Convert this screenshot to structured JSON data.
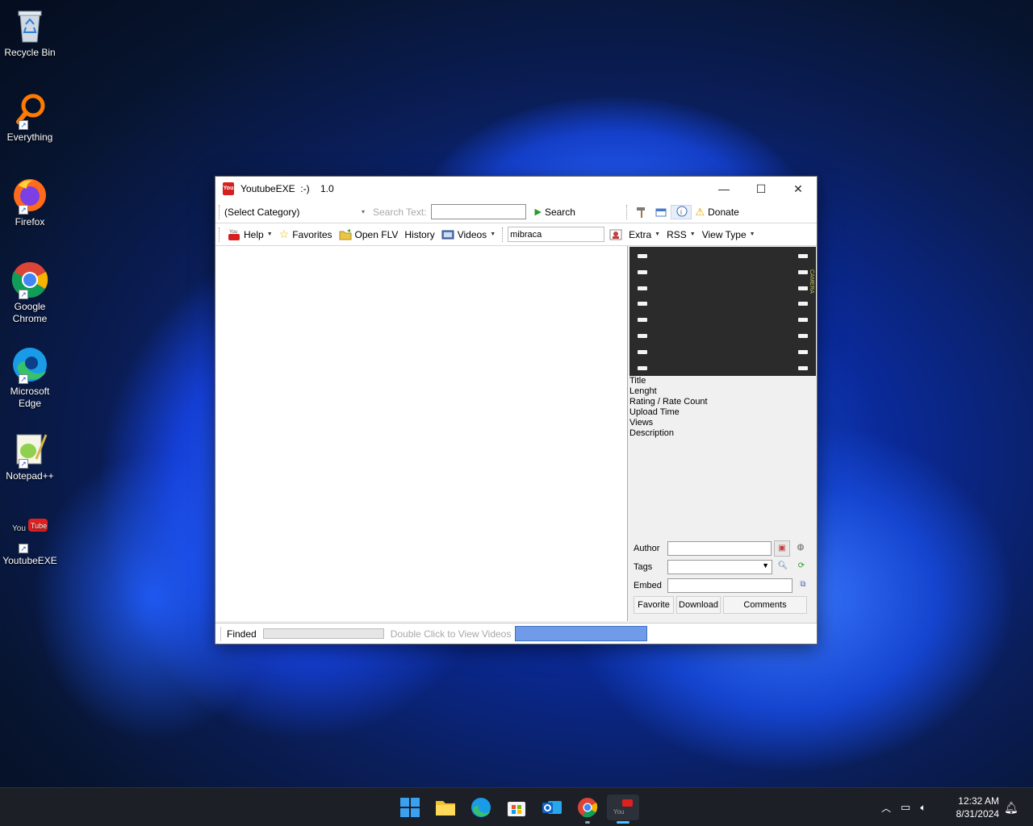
{
  "desktop": {
    "icons": [
      {
        "label": "Recycle Bin"
      },
      {
        "label": "Everything"
      },
      {
        "label": "Firefox"
      },
      {
        "label": "Google Chrome"
      },
      {
        "label": "Microsoft Edge"
      },
      {
        "label": "Notepad++"
      },
      {
        "label": "YoutubeEXE"
      }
    ]
  },
  "window": {
    "title": "YoutubeEXE  :-)    1.0",
    "app_icon_text": "You",
    "controls": {
      "minimize": "—",
      "maximize": "☐",
      "close": "✕"
    },
    "toolbar1": {
      "category_value": "(Select Category)",
      "search_placeholder": "Search Text:",
      "search_value": "",
      "search_button": "Search",
      "donate": "Donate"
    },
    "toolbar2": {
      "help": "Help",
      "favorites": "Favorites",
      "open_flv": "Open FLV",
      "history": "History",
      "videos": "Videos",
      "channel_value": "mibraca",
      "extra": "Extra",
      "rss": "RSS",
      "view_type": "View Type"
    },
    "details": {
      "title": "Title",
      "length": "Lenght",
      "rating": "Rating / Rate Count",
      "upload_time": "Upload Time",
      "views": "Views",
      "description": "Description"
    },
    "form": {
      "author_label": "Author",
      "tags_label": "Tags",
      "embed_label": "Embed",
      "author_value": "",
      "tags_value": "",
      "embed_value": "",
      "favorite_button": "Favorite",
      "download_button": "Download",
      "comments_button": "Comments"
    },
    "statusbar": {
      "status": "Finded",
      "hint": "Double Click to View Videos"
    }
  },
  "taskbar": {
    "apps": [
      "start",
      "file-explorer",
      "edge",
      "store",
      "outlook",
      "chrome",
      "youtubeexe"
    ],
    "clock_time": "12:32 AM",
    "clock_date": "8/31/2024"
  },
  "colors": {
    "accent": "#6f9be8",
    "film": "#2b2b2b",
    "taskbar": "#1c1f26"
  }
}
